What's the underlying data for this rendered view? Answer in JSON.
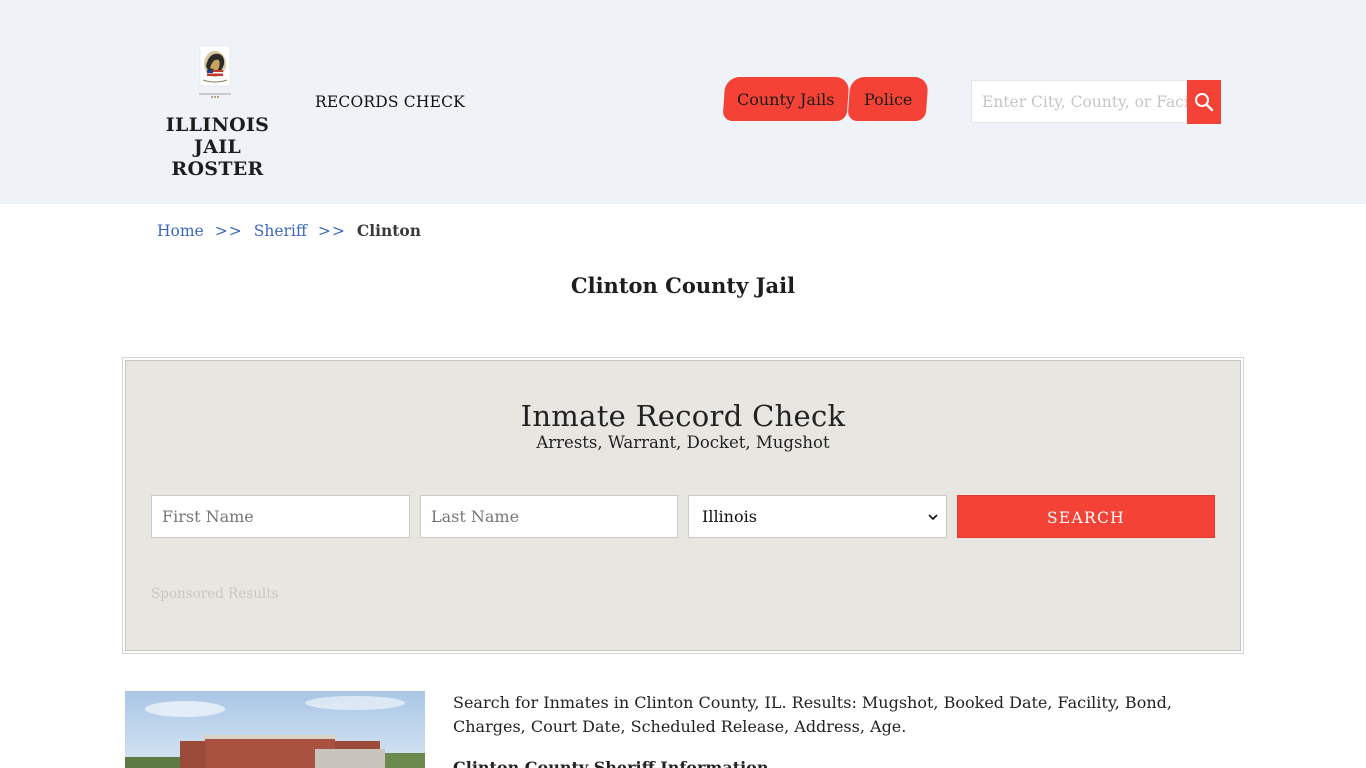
{
  "header": {
    "logo": {
      "line1": "ILLINOIS",
      "line2": "JAIL ROSTER"
    },
    "records_check_label": "RECORDS CHECK",
    "nav": [
      {
        "label": "County Jails"
      },
      {
        "label": "Police"
      }
    ],
    "search": {
      "placeholder": "Enter City, County, or Facility"
    }
  },
  "breadcrumb": {
    "home": "Home",
    "sep": ">>",
    "sheriff": "Sheriff",
    "current": "Clinton"
  },
  "page_title": "Clinton County Jail",
  "record_check": {
    "title": "Inmate Record Check",
    "subtitle": "Arrests, Warrant, Docket, Mugshot",
    "first_name_placeholder": "First Name",
    "last_name_placeholder": "Last Name",
    "state_selected": "Illinois",
    "search_label": "SEARCH",
    "sponsored": "Sponsored Results"
  },
  "content": {
    "intro": "Search for Inmates in Clinton County, IL. Results: Mugshot, Booked Date, Facility, Bond, Charges, Court Date, Scheduled Release, Address, Age.",
    "section_heading": "Clinton County Sheriff Information"
  },
  "colors": {
    "accent": "#f44336",
    "header_bg": "#eff3f8",
    "panel_bg": "#e8e6e1",
    "link": "#3a67c4"
  }
}
